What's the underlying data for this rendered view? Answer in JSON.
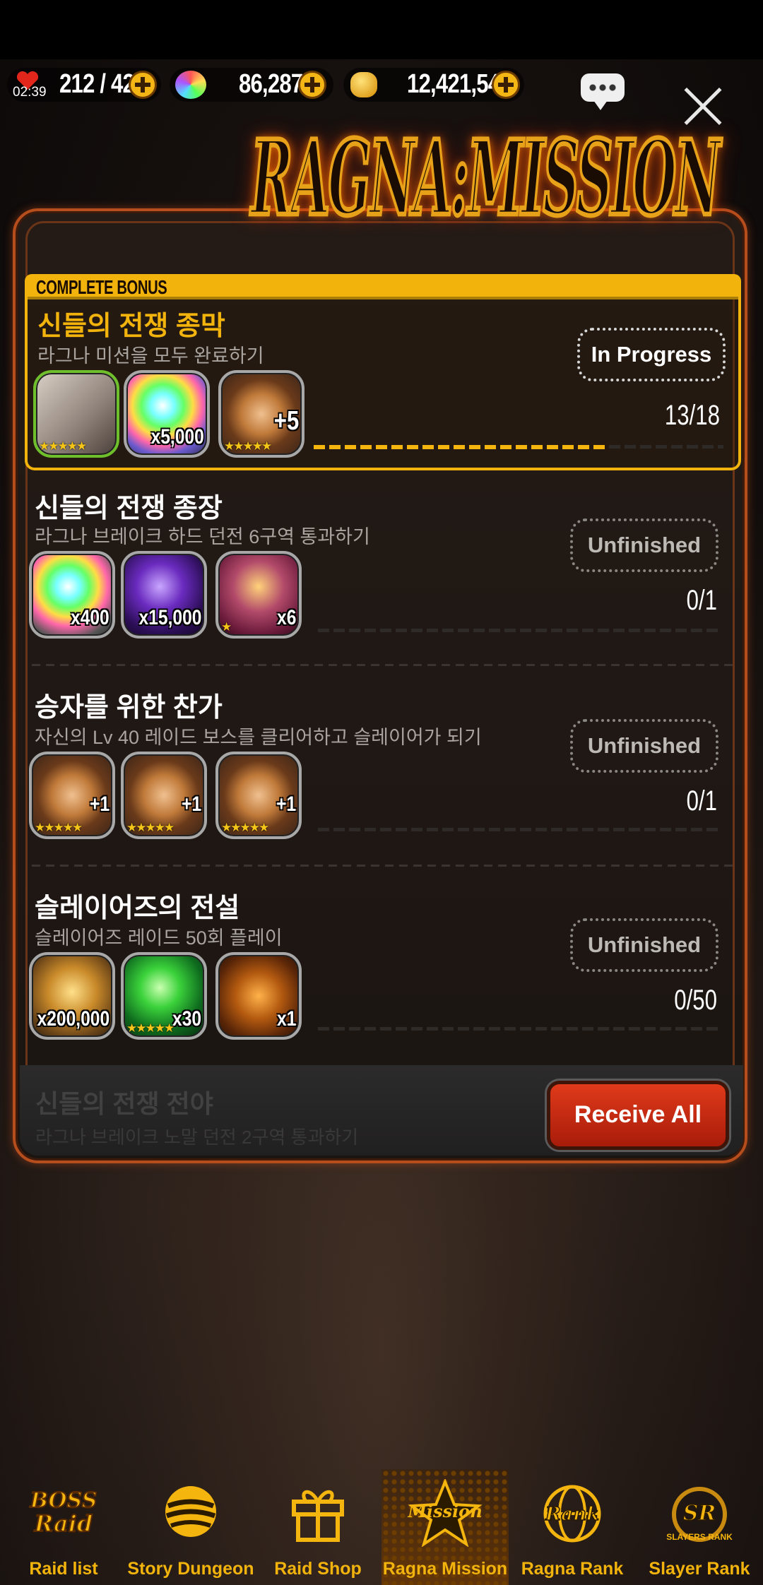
{
  "resources": {
    "stamina_timer": "02:39",
    "stamina": "212 / 421",
    "gems": "86,287",
    "gold": "12,421,542"
  },
  "title": "RAGNA:MISSION",
  "complete_bonus_label": "COMPLETE BONUS",
  "missions": [
    {
      "title": "신들의 전쟁 종막",
      "desc": "라그나 미션을 모두 완료하기",
      "status": "In Progress",
      "count": "13/18",
      "progress": 0.72,
      "rewards": [
        {
          "icon": "character-portrait-icon",
          "amount": "",
          "stars": "★★★★★"
        },
        {
          "icon": "rainbow-gem-icon",
          "amount": "x5,000",
          "stars": ""
        },
        {
          "icon": "enhance-ring-icon",
          "amount": "+5",
          "stars": "★★★★★"
        }
      ]
    },
    {
      "title": "신들의 전쟁 종장",
      "desc": "라그나 브레이크 하드 던전 6구역 통과하기",
      "status": "Unfinished",
      "count": "0/1",
      "progress": 0,
      "rewards": [
        {
          "icon": "rainbow-gem-icon",
          "amount": "x400",
          "stars": ""
        },
        {
          "icon": "purple-crystal-icon",
          "amount": "x15,000",
          "stars": ""
        },
        {
          "icon": "trophy-icon",
          "amount": "x6",
          "stars": "★"
        }
      ]
    },
    {
      "title": "승자를 위한 찬가",
      "desc": "자신의 Lv 40 레이드 보스를 클리어하고 슬레이어가 되기",
      "status": "Unfinished",
      "count": "0/1",
      "progress": 0,
      "rewards": [
        {
          "icon": "enhance-ring-icon",
          "amount": "+1",
          "stars": "★★★★★"
        },
        {
          "icon": "enhance-ring-icon",
          "amount": "+1",
          "stars": "★★★★★"
        },
        {
          "icon": "enhance-ring-icon",
          "amount": "+1",
          "stars": "★★★★★"
        }
      ]
    },
    {
      "title": "슬레이어즈의 전설",
      "desc": "슬레이어즈 레이드 50회 플레이",
      "status": "Unfinished",
      "count": "0/50",
      "progress": 0,
      "rewards": [
        {
          "icon": "gold-coins-icon",
          "amount": "x200,000",
          "stars": ""
        },
        {
          "icon": "green-gem-icon",
          "amount": "x30",
          "stars": "★★★★★"
        },
        {
          "icon": "ticket-icon",
          "amount": "x1",
          "stars": ""
        }
      ]
    }
  ],
  "ghost_mission": {
    "title": "신들의 전쟁 전야",
    "desc": "라그나 브레이크 노말 던전 2구역 통과하기"
  },
  "receive_all": "Receive All",
  "nav": [
    {
      "label": "Raid list",
      "icon": "boss-raid-icon",
      "active": false
    },
    {
      "label": "Story Dungeon",
      "icon": "story-orb-icon",
      "active": false
    },
    {
      "label": "Raid Shop",
      "icon": "gift-box-icon",
      "active": false
    },
    {
      "label": "Ragna Mission",
      "icon": "mission-star-icon",
      "active": true
    },
    {
      "label": "Ragna Rank",
      "icon": "rank-globe-icon",
      "active": false
    },
    {
      "label": "Slayer Rank",
      "icon": "slayer-rank-icon",
      "active": false
    }
  ],
  "icon_texts": {
    "boss_raid": [
      "BOSS",
      "Raid"
    ],
    "mission": "Mission",
    "rank": "Rank",
    "slayer": "SLAYERS RANK"
  },
  "colors": {
    "accent": "#f2b40c",
    "panel_border": "#b64d1c",
    "button_red": "#c02a12"
  }
}
